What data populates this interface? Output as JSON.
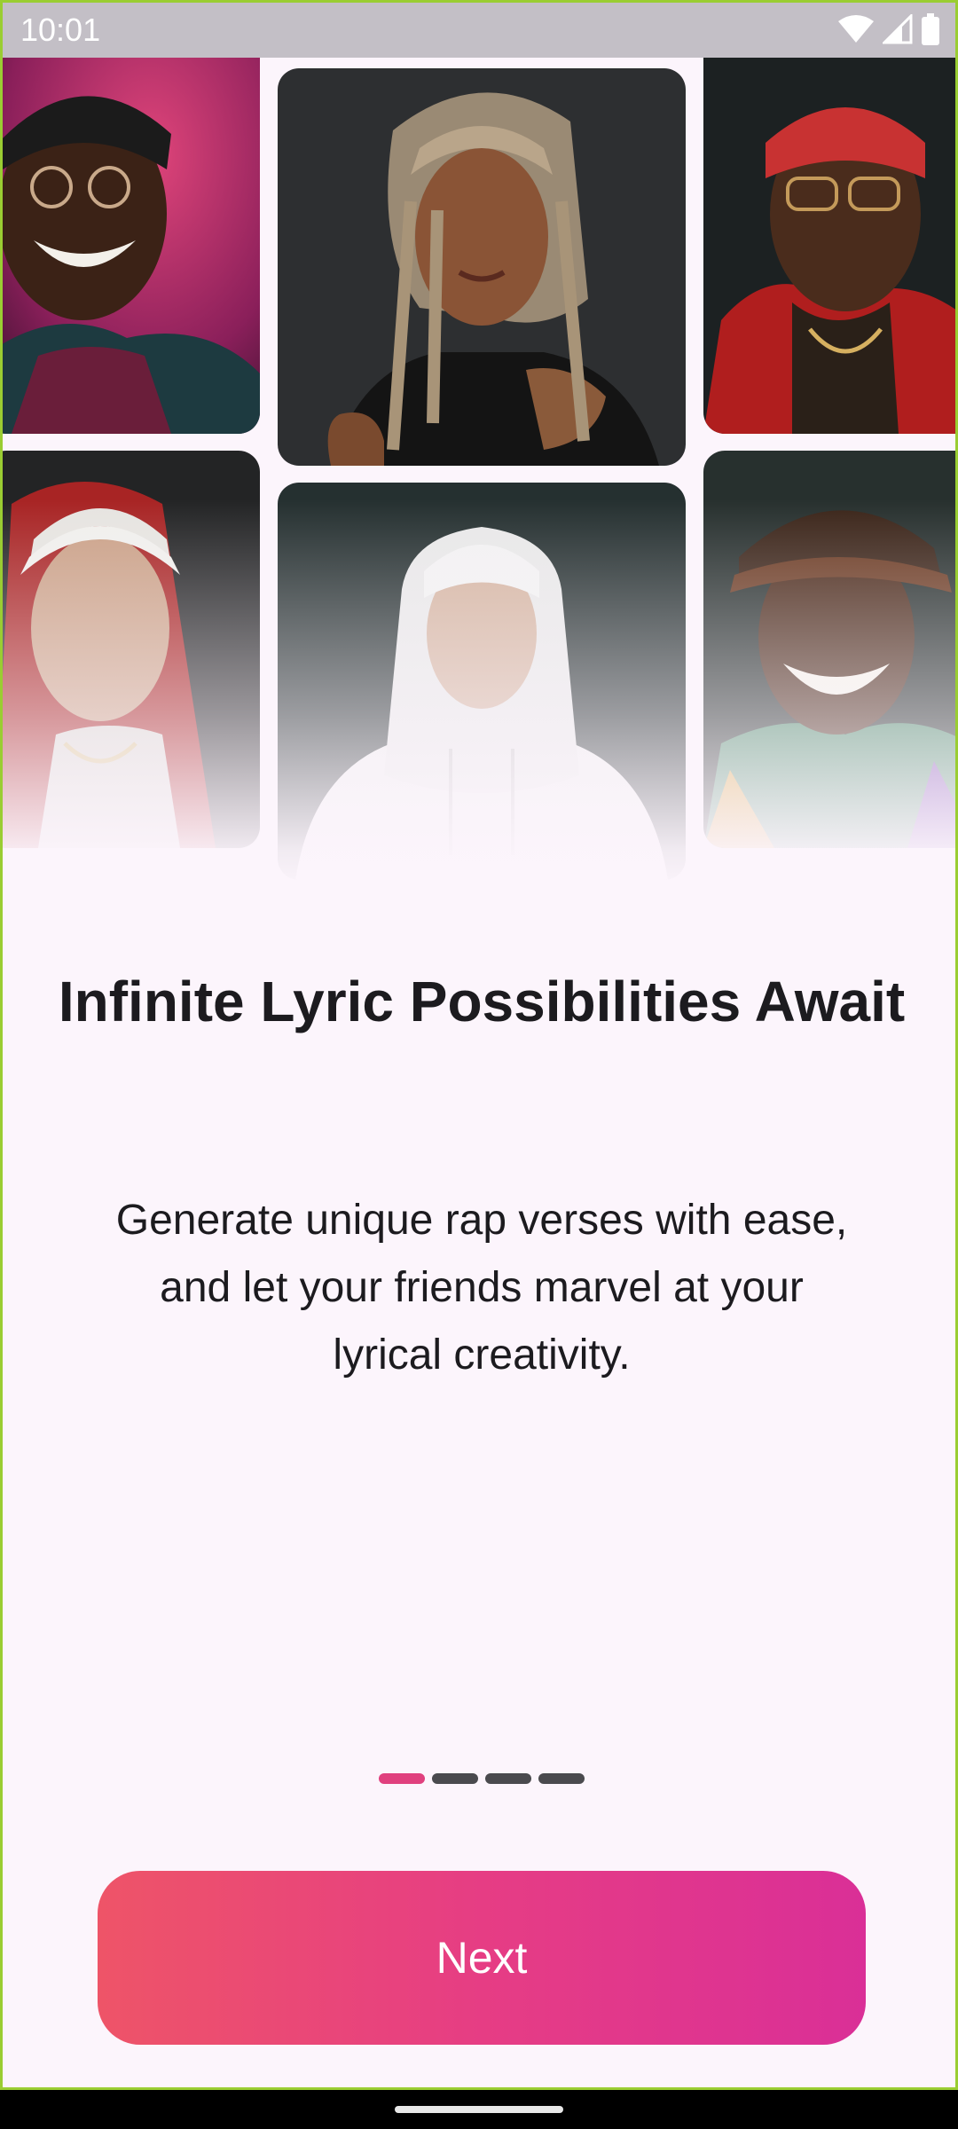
{
  "status_bar": {
    "time": "10:01",
    "icons": [
      "wifi-icon",
      "cellular-signal-icon",
      "battery-icon"
    ]
  },
  "gallery": {
    "portraits": [
      {
        "name": "portrait-smiling-man-glasses",
        "description_icon": "person-photo"
      },
      {
        "name": "portrait-woman-braids",
        "description_icon": "person-photo"
      },
      {
        "name": "portrait-man-red-beanie",
        "description_icon": "person-photo"
      },
      {
        "name": "portrait-man-white-cap-red-hood",
        "description_icon": "person-photo"
      },
      {
        "name": "portrait-man-white-hoodie",
        "description_icon": "person-photo"
      },
      {
        "name": "portrait-smiling-man-cap",
        "description_icon": "person-photo"
      }
    ]
  },
  "onboarding": {
    "title": "Infinite Lyric Possibilities Await",
    "subtitle": "Generate unique rap verses with ease, and let your friends marvel at your lyrical creativity.",
    "page_indicator": {
      "current": 1,
      "total": 4
    }
  },
  "actions": {
    "next_label": "Next"
  },
  "colors": {
    "background": "#fcf5fc",
    "accent_start": "#ee5468",
    "accent_end": "#da2f97",
    "active_dot": "#e0407e",
    "inactive_dot": "#4a4a4e"
  }
}
